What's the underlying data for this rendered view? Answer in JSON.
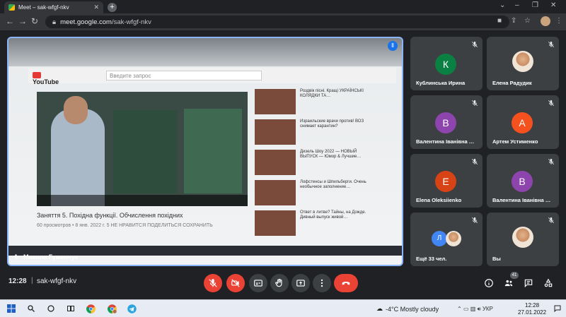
{
  "browser": {
    "tab_title": "Meet – sak-wfgf-nkv",
    "url_host": "meet.google.com",
    "url_path": "/sak-wfgf-nkv"
  },
  "presentation": {
    "presenter_name": "Микола Гуменчук",
    "inner_search_placeholder": "Введите запрос",
    "inner_video_title": "Заняття 5. Похідна функції. Обчислення похідних",
    "inner_video_meta": "60 просмотров • 8 янв. 2022 г.   5   НЕ НРАВИТСЯ   ПОДЕЛИТЬСЯ   СОХРАНИТЬ",
    "inner_sidebar": [
      "Роздвік пісні. Кращі УКРАЇНСЬКІ КОЛЯДКИ ТА…",
      "Израильские врачи против! ВОЗ снимает карантин?",
      "Дизель Шоу 2022 — НОВЫЙ ВЫПУСК — Юмор & Лучшие…",
      "Лофстенсы и Шпильберги. Очень необычное заполнение…",
      "Ответ в литве? Тайны, на Дожде. Дивный выпуск живой…"
    ]
  },
  "participants": [
    {
      "name": "Кублинська Ирина",
      "initial": "К",
      "color": "#0b8043",
      "photo": false
    },
    {
      "name": "Елена Радудик",
      "initial": "",
      "color": "",
      "photo": true
    },
    {
      "name": "Валентина Іванівна …",
      "initial": "В",
      "color": "#8e44ad",
      "photo": false
    },
    {
      "name": "Артем Устименко",
      "initial": "А",
      "color": "#f4511e",
      "photo": false
    },
    {
      "name": "Elena Oleksiienko",
      "initial": "Е",
      "color": "#d84315",
      "photo": false
    },
    {
      "name": "Валентина Іванівна …",
      "initial": "В",
      "color": "#8e44ad",
      "photo": false
    },
    {
      "name": "Ещё 33 чел.",
      "initial": "Л",
      "color": "#4285f4",
      "photo": false
    },
    {
      "name": "Вы",
      "initial": "",
      "color": "",
      "photo": true
    }
  ],
  "bottom": {
    "time": "12:28",
    "meeting_code": "sak-wfgf-nkv",
    "people_count": "41"
  },
  "taskbar": {
    "weather": "-4°C  Mostly cloudy",
    "lang": "УКР",
    "clock_time": "12:28",
    "clock_date": "27.01.2022"
  },
  "icons": {
    "mic": "mic-off-icon",
    "cam": "camera-off-icon",
    "cc": "captions-icon",
    "hand": "raise-hand-icon",
    "present": "present-icon",
    "more": "more-vert-icon",
    "end": "end-call-icon",
    "info": "info-icon",
    "people": "people-icon",
    "chat": "chat-icon",
    "activities": "activities-icon"
  }
}
